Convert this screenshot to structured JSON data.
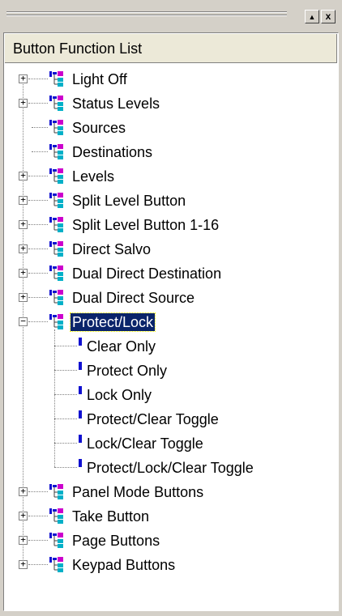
{
  "window": {
    "pin_button": "▲",
    "close_button": "x"
  },
  "panel": {
    "header": "Button Function List"
  },
  "tree": {
    "top": [
      {
        "label": "Light Off",
        "expandable": true
      },
      {
        "label": "Status Levels",
        "expandable": true
      },
      {
        "label": "Sources",
        "expandable": false
      },
      {
        "label": "Destinations",
        "expandable": false
      },
      {
        "label": "Levels",
        "expandable": true
      },
      {
        "label": "Split Level Button",
        "expandable": true
      },
      {
        "label": "Split Level Button 1-16",
        "expandable": true
      },
      {
        "label": "Direct Salvo",
        "expandable": true
      },
      {
        "label": "Dual Direct Destination",
        "expandable": true
      },
      {
        "label": "Dual Direct Source",
        "expandable": true
      },
      {
        "label": "Protect/Lock",
        "expandable": true,
        "expanded": true,
        "selected": true
      }
    ],
    "children": [
      {
        "label": "Clear Only"
      },
      {
        "label": "Protect Only"
      },
      {
        "label": "Lock Only"
      },
      {
        "label": "Protect/Clear Toggle"
      },
      {
        "label": "Lock/Clear Toggle"
      },
      {
        "label": "Protect/Lock/Clear Toggle"
      }
    ],
    "bottom": [
      {
        "label": "Panel Mode Buttons",
        "expandable": true
      },
      {
        "label": "Take Button",
        "expandable": true
      },
      {
        "label": "Page Buttons",
        "expandable": true
      },
      {
        "label": "Keypad Buttons",
        "expandable": true
      }
    ],
    "expander_collapsed": "+",
    "expander_expanded": "−"
  },
  "colors": {
    "selection": "#0a246a",
    "icon_blue": "#1010d0",
    "icon_magenta": "#cc00cc",
    "icon_cyan": "#00b0c8"
  }
}
